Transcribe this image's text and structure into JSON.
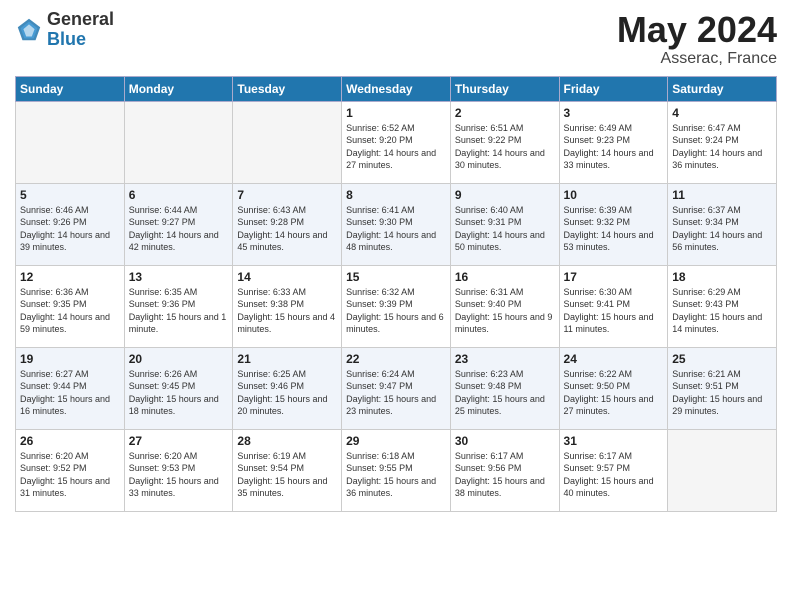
{
  "header": {
    "logo_general": "General",
    "logo_blue": "Blue",
    "title": "May 2024",
    "location": "Asserac, France"
  },
  "days_of_week": [
    "Sunday",
    "Monday",
    "Tuesday",
    "Wednesday",
    "Thursday",
    "Friday",
    "Saturday"
  ],
  "weeks": [
    [
      {
        "day": "",
        "info": ""
      },
      {
        "day": "",
        "info": ""
      },
      {
        "day": "",
        "info": ""
      },
      {
        "day": "1",
        "info": "Sunrise: 6:52 AM\nSunset: 9:20 PM\nDaylight: 14 hours and 27 minutes."
      },
      {
        "day": "2",
        "info": "Sunrise: 6:51 AM\nSunset: 9:22 PM\nDaylight: 14 hours and 30 minutes."
      },
      {
        "day": "3",
        "info": "Sunrise: 6:49 AM\nSunset: 9:23 PM\nDaylight: 14 hours and 33 minutes."
      },
      {
        "day": "4",
        "info": "Sunrise: 6:47 AM\nSunset: 9:24 PM\nDaylight: 14 hours and 36 minutes."
      }
    ],
    [
      {
        "day": "5",
        "info": "Sunrise: 6:46 AM\nSunset: 9:26 PM\nDaylight: 14 hours and 39 minutes."
      },
      {
        "day": "6",
        "info": "Sunrise: 6:44 AM\nSunset: 9:27 PM\nDaylight: 14 hours and 42 minutes."
      },
      {
        "day": "7",
        "info": "Sunrise: 6:43 AM\nSunset: 9:28 PM\nDaylight: 14 hours and 45 minutes."
      },
      {
        "day": "8",
        "info": "Sunrise: 6:41 AM\nSunset: 9:30 PM\nDaylight: 14 hours and 48 minutes."
      },
      {
        "day": "9",
        "info": "Sunrise: 6:40 AM\nSunset: 9:31 PM\nDaylight: 14 hours and 50 minutes."
      },
      {
        "day": "10",
        "info": "Sunrise: 6:39 AM\nSunset: 9:32 PM\nDaylight: 14 hours and 53 minutes."
      },
      {
        "day": "11",
        "info": "Sunrise: 6:37 AM\nSunset: 9:34 PM\nDaylight: 14 hours and 56 minutes."
      }
    ],
    [
      {
        "day": "12",
        "info": "Sunrise: 6:36 AM\nSunset: 9:35 PM\nDaylight: 14 hours and 59 minutes."
      },
      {
        "day": "13",
        "info": "Sunrise: 6:35 AM\nSunset: 9:36 PM\nDaylight: 15 hours and 1 minute."
      },
      {
        "day": "14",
        "info": "Sunrise: 6:33 AM\nSunset: 9:38 PM\nDaylight: 15 hours and 4 minutes."
      },
      {
        "day": "15",
        "info": "Sunrise: 6:32 AM\nSunset: 9:39 PM\nDaylight: 15 hours and 6 minutes."
      },
      {
        "day": "16",
        "info": "Sunrise: 6:31 AM\nSunset: 9:40 PM\nDaylight: 15 hours and 9 minutes."
      },
      {
        "day": "17",
        "info": "Sunrise: 6:30 AM\nSunset: 9:41 PM\nDaylight: 15 hours and 11 minutes."
      },
      {
        "day": "18",
        "info": "Sunrise: 6:29 AM\nSunset: 9:43 PM\nDaylight: 15 hours and 14 minutes."
      }
    ],
    [
      {
        "day": "19",
        "info": "Sunrise: 6:27 AM\nSunset: 9:44 PM\nDaylight: 15 hours and 16 minutes."
      },
      {
        "day": "20",
        "info": "Sunrise: 6:26 AM\nSunset: 9:45 PM\nDaylight: 15 hours and 18 minutes."
      },
      {
        "day": "21",
        "info": "Sunrise: 6:25 AM\nSunset: 9:46 PM\nDaylight: 15 hours and 20 minutes."
      },
      {
        "day": "22",
        "info": "Sunrise: 6:24 AM\nSunset: 9:47 PM\nDaylight: 15 hours and 23 minutes."
      },
      {
        "day": "23",
        "info": "Sunrise: 6:23 AM\nSunset: 9:48 PM\nDaylight: 15 hours and 25 minutes."
      },
      {
        "day": "24",
        "info": "Sunrise: 6:22 AM\nSunset: 9:50 PM\nDaylight: 15 hours and 27 minutes."
      },
      {
        "day": "25",
        "info": "Sunrise: 6:21 AM\nSunset: 9:51 PM\nDaylight: 15 hours and 29 minutes."
      }
    ],
    [
      {
        "day": "26",
        "info": "Sunrise: 6:20 AM\nSunset: 9:52 PM\nDaylight: 15 hours and 31 minutes."
      },
      {
        "day": "27",
        "info": "Sunrise: 6:20 AM\nSunset: 9:53 PM\nDaylight: 15 hours and 33 minutes."
      },
      {
        "day": "28",
        "info": "Sunrise: 6:19 AM\nSunset: 9:54 PM\nDaylight: 15 hours and 35 minutes."
      },
      {
        "day": "29",
        "info": "Sunrise: 6:18 AM\nSunset: 9:55 PM\nDaylight: 15 hours and 36 minutes."
      },
      {
        "day": "30",
        "info": "Sunrise: 6:17 AM\nSunset: 9:56 PM\nDaylight: 15 hours and 38 minutes."
      },
      {
        "day": "31",
        "info": "Sunrise: 6:17 AM\nSunset: 9:57 PM\nDaylight: 15 hours and 40 minutes."
      },
      {
        "day": "",
        "info": ""
      }
    ]
  ]
}
